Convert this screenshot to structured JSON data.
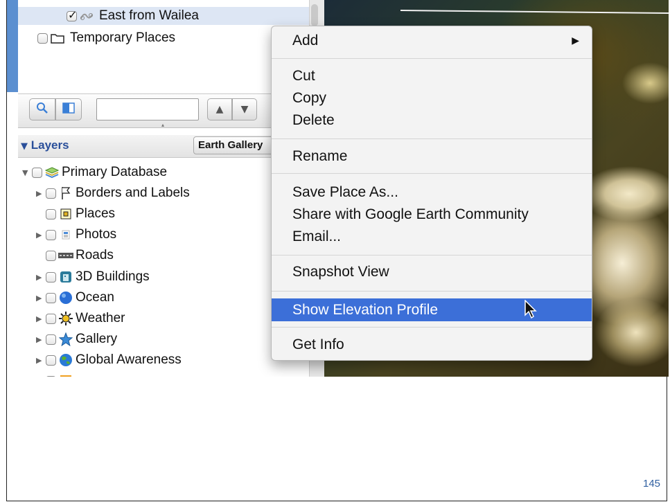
{
  "places": {
    "items": [
      {
        "label": "East from Wailea",
        "checked": true,
        "icon": "path-icon"
      },
      {
        "label": "Temporary Places",
        "checked": false,
        "icon": "folder-icon"
      }
    ]
  },
  "toolbar": {
    "search_icon": "search-icon",
    "panel_icon": "panel-toggle-icon",
    "search_value": "",
    "up_icon": "arrow-up-icon",
    "down_icon": "arrow-down-icon"
  },
  "layers": {
    "title": "Layers",
    "gallery_button": "Earth Gallery",
    "items": [
      {
        "label": "Primary Database",
        "icon": "database-icon",
        "expander": "open"
      },
      {
        "label": "Borders and Labels",
        "icon": "flag-icon",
        "expander": "closed"
      },
      {
        "label": "Places",
        "icon": "places-icon",
        "expander": "none"
      },
      {
        "label": "Photos",
        "icon": "photos-icon",
        "expander": "closed"
      },
      {
        "label": "Roads",
        "icon": "roads-icon",
        "expander": "none"
      },
      {
        "label": "3D Buildings",
        "icon": "buildings-icon",
        "expander": "closed"
      },
      {
        "label": "Ocean",
        "icon": "ocean-icon",
        "expander": "closed"
      },
      {
        "label": "Weather",
        "icon": "weather-icon",
        "expander": "closed"
      },
      {
        "label": "Gallery",
        "icon": "star-icon",
        "expander": "closed"
      },
      {
        "label": "Global Awareness",
        "icon": "globe-icon",
        "expander": "closed"
      }
    ]
  },
  "context_menu": {
    "add": "Add",
    "cut": "Cut",
    "copy": "Copy",
    "delete": "Delete",
    "rename": "Rename",
    "save_place_as": "Save Place As...",
    "share": "Share with Google Earth Community",
    "email": "Email...",
    "snapshot_view": "Snapshot View",
    "show_elevation_profile": "Show Elevation Profile",
    "get_info": "Get Info",
    "highlighted_item": "Show Elevation Profile"
  },
  "page_number": "145",
  "colors": {
    "menu_highlight": "#3c6fd8",
    "layers_title": "#2a4f9a",
    "sidebar_accent": "#5b8fd0",
    "page_number": "#2f5fa0"
  }
}
